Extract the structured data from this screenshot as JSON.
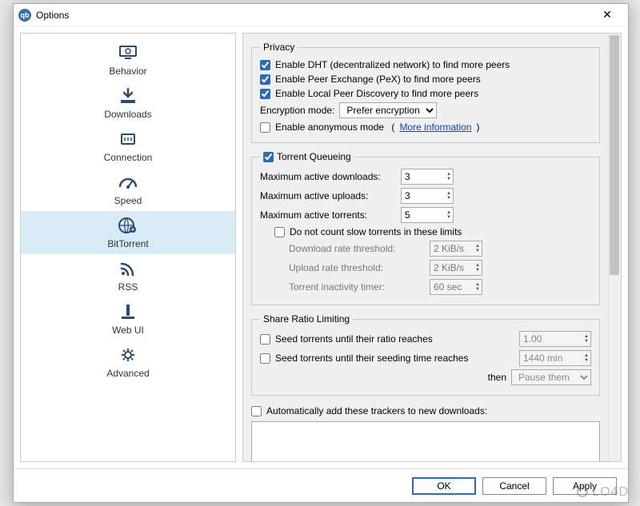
{
  "window": {
    "title": "Options"
  },
  "sidebar": {
    "items": [
      {
        "key": "behavior",
        "label": "Behavior"
      },
      {
        "key": "downloads",
        "label": "Downloads"
      },
      {
        "key": "connection",
        "label": "Connection"
      },
      {
        "key": "speed",
        "label": "Speed"
      },
      {
        "key": "bittorrent",
        "label": "BitTorrent"
      },
      {
        "key": "rss",
        "label": "RSS"
      },
      {
        "key": "webui",
        "label": "Web UI"
      },
      {
        "key": "advanced",
        "label": "Advanced"
      }
    ],
    "selected": "bittorrent"
  },
  "privacy": {
    "title": "Privacy",
    "dht_label": "Enable DHT (decentralized network) to find more peers",
    "dht_checked": true,
    "pex_label": "Enable Peer Exchange (PeX) to find more peers",
    "pex_checked": true,
    "lpd_label": "Enable Local Peer Discovery to find more peers",
    "lpd_checked": true,
    "enc_label": "Encryption mode:",
    "enc_value": "Prefer encryption",
    "anon_label": "Enable anonymous mode",
    "anon_checked": false,
    "more_info": "More information"
  },
  "queue": {
    "title": "Torrent Queueing",
    "enabled": true,
    "max_dl_label": "Maximum active downloads:",
    "max_dl_value": "3",
    "max_up_label": "Maximum active uploads:",
    "max_up_value": "3",
    "max_active_label": "Maximum active torrents:",
    "max_active_value": "5",
    "slow_label": "Do not count slow torrents in these limits",
    "slow_checked": false,
    "dl_thresh_label": "Download rate threshold:",
    "dl_thresh_value": "2 KiB/s",
    "up_thresh_label": "Upload rate threshold:",
    "up_thresh_value": "2 KiB/s",
    "inactive_label": "Torrent inactivity timer:",
    "inactive_value": "60 sec"
  },
  "ratio": {
    "title": "Share Ratio Limiting",
    "seed_ratio_label": "Seed torrents until their ratio reaches",
    "seed_ratio_checked": false,
    "seed_ratio_value": "1.00",
    "seed_time_label": "Seed torrents until their seeding time reaches",
    "seed_time_checked": false,
    "seed_time_value": "1440 min",
    "then_label": "then",
    "then_value": "Pause them"
  },
  "trackers": {
    "label": "Automatically add these trackers to new downloads:",
    "checked": false,
    "value": ""
  },
  "buttons": {
    "ok": "OK",
    "cancel": "Cancel",
    "apply": "Apply"
  }
}
